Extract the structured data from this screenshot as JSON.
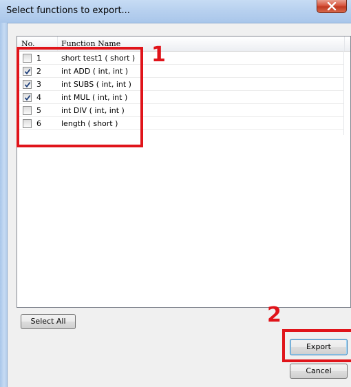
{
  "window": {
    "title": "Select functions to export..."
  },
  "list": {
    "headers": {
      "no": "No.",
      "name": "Function Name"
    },
    "rows": [
      {
        "no": "1",
        "name": "short test1 ( short )",
        "checked": false
      },
      {
        "no": "2",
        "name": "int ADD ( int, int )",
        "checked": true
      },
      {
        "no": "3",
        "name": "int SUBS ( int, int )",
        "checked": true
      },
      {
        "no": "4",
        "name": "int MUL ( int, int )",
        "checked": true
      },
      {
        "no": "5",
        "name": "int DIV ( int, int )",
        "checked": false
      },
      {
        "no": "6",
        "name": "length ( short )",
        "checked": false
      }
    ]
  },
  "buttons": {
    "select_all": "Select All",
    "export": "Export",
    "cancel": "Cancel"
  },
  "annotations": {
    "label_1": "1",
    "label_2": "2",
    "color": "#e0141a"
  },
  "icons": {
    "close": "close-x-icon",
    "check": "checkmark-icon"
  }
}
